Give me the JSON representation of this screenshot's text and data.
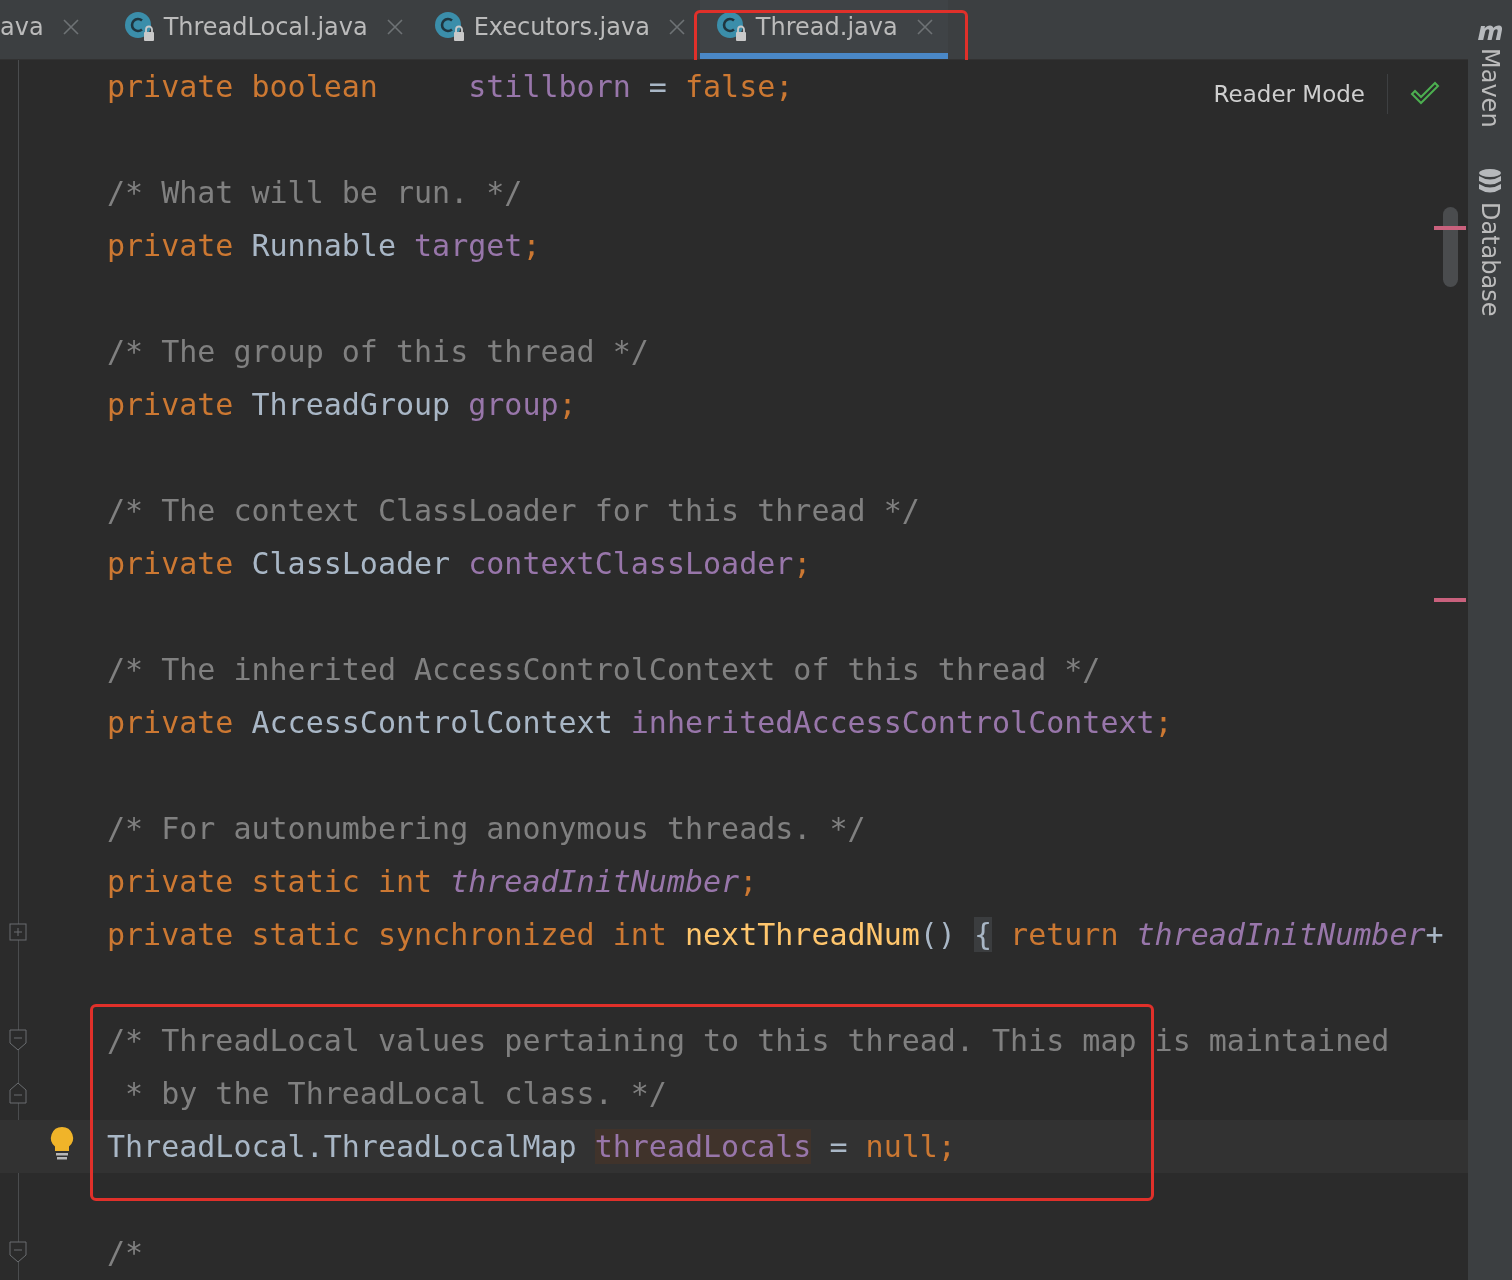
{
  "tabs": [
    {
      "label": "ava",
      "kind": "partial",
      "selected": false,
      "annotated": false
    },
    {
      "label": "ThreadLocal.java",
      "kind": "class",
      "selected": false,
      "annotated": false
    },
    {
      "label": "Executors.java",
      "kind": "class",
      "selected": false,
      "annotated": false
    },
    {
      "label": "Thread.java",
      "kind": "class",
      "selected": true,
      "annotated": true
    }
  ],
  "reader_mode": {
    "label": "Reader Mode"
  },
  "side_tools": [
    {
      "label": "Maven",
      "kind": "maven"
    },
    {
      "label": "Database",
      "kind": "database"
    }
  ],
  "lines": [
    {
      "kind": "code",
      "tokens": [
        {
          "text": "private boolean     ",
          "kind": "keyword"
        },
        {
          "text": "stillborn",
          "kind": "field"
        },
        {
          "text": " = ",
          "kind": "plain"
        },
        {
          "text": "false;",
          "kind": "keyword"
        }
      ]
    },
    {
      "kind": "blank"
    },
    {
      "kind": "code",
      "tokens": [
        {
          "text": "/* What will be run. */",
          "kind": "comment"
        }
      ]
    },
    {
      "kind": "code",
      "tokens": [
        {
          "text": "private ",
          "kind": "keyword"
        },
        {
          "text": "Runnable ",
          "kind": "plain"
        },
        {
          "text": "target",
          "kind": "field"
        },
        {
          "text": ";",
          "kind": "keyword"
        }
      ]
    },
    {
      "kind": "blank"
    },
    {
      "kind": "code",
      "tokens": [
        {
          "text": "/* The group of this thread */",
          "kind": "comment"
        }
      ]
    },
    {
      "kind": "code",
      "tokens": [
        {
          "text": "private ",
          "kind": "keyword"
        },
        {
          "text": "ThreadGroup ",
          "kind": "plain"
        },
        {
          "text": "group",
          "kind": "field"
        },
        {
          "text": ";",
          "kind": "keyword"
        }
      ]
    },
    {
      "kind": "blank"
    },
    {
      "kind": "code",
      "tokens": [
        {
          "text": "/* The context ClassLoader for this thread */",
          "kind": "comment"
        }
      ]
    },
    {
      "kind": "code",
      "tokens": [
        {
          "text": "private ",
          "kind": "keyword"
        },
        {
          "text": "ClassLoader ",
          "kind": "plain"
        },
        {
          "text": "contextClassLoader",
          "kind": "field"
        },
        {
          "text": ";",
          "kind": "keyword"
        }
      ]
    },
    {
      "kind": "blank"
    },
    {
      "kind": "code",
      "tokens": [
        {
          "text": "/* The inherited AccessControlContext of this thread */",
          "kind": "comment"
        }
      ]
    },
    {
      "kind": "code",
      "tokens": [
        {
          "text": "private ",
          "kind": "keyword"
        },
        {
          "text": "AccessControlContext ",
          "kind": "plain"
        },
        {
          "text": "inheritedAccessControlContext",
          "kind": "field"
        },
        {
          "text": ";",
          "kind": "keyword"
        }
      ]
    },
    {
      "kind": "blank"
    },
    {
      "kind": "code",
      "tokens": [
        {
          "text": "/* For autonumbering anonymous threads. */",
          "kind": "comment"
        }
      ]
    },
    {
      "kind": "code",
      "tokens": [
        {
          "text": "private static int ",
          "kind": "keyword"
        },
        {
          "text": "threadInitNumber",
          "kind": "static"
        },
        {
          "text": ";",
          "kind": "keyword"
        }
      ]
    },
    {
      "kind": "code",
      "gutter": {
        "kind": "plus"
      },
      "tokens": [
        {
          "text": "private static synchronized int ",
          "kind": "keyword"
        },
        {
          "text": "nextThreadNum",
          "kind": "method"
        },
        {
          "text": "() ",
          "kind": "plain"
        },
        {
          "text": "{",
          "kind": "brace"
        },
        {
          "text": " return ",
          "kind": "keyword"
        },
        {
          "text": "threadInitNumber",
          "kind": "static"
        },
        {
          "text": "+",
          "kind": "plain"
        }
      ]
    },
    {
      "kind": "blank"
    },
    {
      "kind": "code",
      "gutter": {
        "kind": "fold"
      },
      "annotated": true,
      "tokens": [
        {
          "text": "/* ThreadLocal values pertaining to this thread. This map is maintained",
          "kind": "comment"
        }
      ]
    },
    {
      "kind": "code",
      "gutter": {
        "kind": "unfold"
      },
      "annotated": true,
      "tokens": [
        {
          "text": " * by the ThreadLocal class. */",
          "kind": "comment"
        }
      ]
    },
    {
      "kind": "code",
      "gutter": {
        "kind": "bulb"
      },
      "annotated": true,
      "current": true,
      "tokens": [
        {
          "text": "ThreadLocal.ThreadLocalMap ",
          "kind": "plain"
        },
        {
          "text": "threadLocals",
          "kind": "usage"
        },
        {
          "text": " = ",
          "kind": "plain"
        },
        {
          "text": "null;",
          "kind": "keyword"
        }
      ]
    },
    {
      "kind": "blank"
    },
    {
      "kind": "code",
      "gutter": {
        "kind": "fold"
      },
      "tokens": [
        {
          "text": "/*",
          "kind": "comment"
        }
      ]
    }
  ]
}
